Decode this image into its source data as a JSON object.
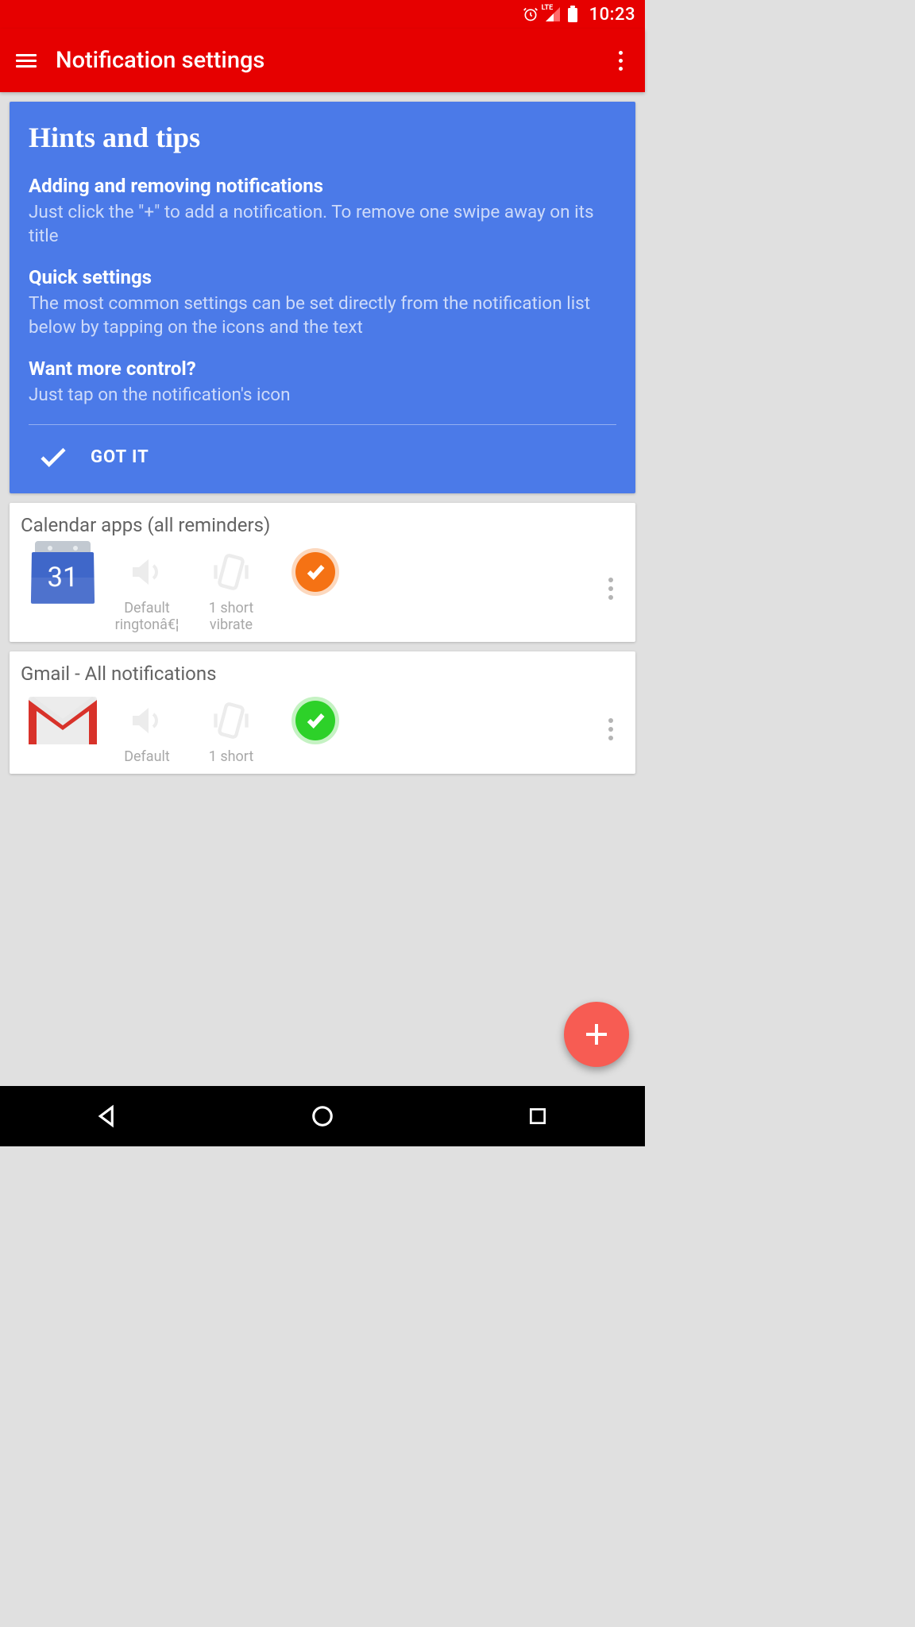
{
  "status": {
    "time": "10:23",
    "lte": "LTE"
  },
  "header": {
    "title": "Notification settings"
  },
  "hints": {
    "title": "Hints and tips",
    "blocks": [
      {
        "sub": "Adding and removing notifications",
        "body": "Just click the \"+\" to add a notification. To remove one swipe away on its title"
      },
      {
        "sub": "Quick settings",
        "body": "The most common settings can be set directly from the notification list below by tapping on the icons and the text"
      },
      {
        "sub": "Want more control?",
        "body": "Just tap on the notification's icon"
      }
    ],
    "gotit": "GOT IT"
  },
  "cards": [
    {
      "title": "Calendar apps (all reminders)",
      "calDay": "31",
      "ringtone": "Default ringtonâ€¦",
      "vibrate": "1 short vibrate",
      "badge": "orange"
    },
    {
      "title": "Gmail - All notifications",
      "ringtone": "Default",
      "vibrate": "1 short",
      "badge": "green"
    }
  ]
}
